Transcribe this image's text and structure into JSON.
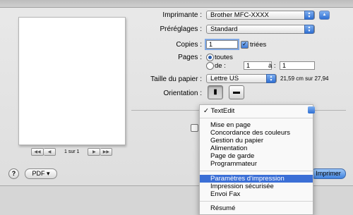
{
  "colors": {
    "accent": "#3b6fd6",
    "menu_highlight": "#3b6fd6"
  },
  "preview": {
    "page_label": "1 sur 1"
  },
  "printer": {
    "label": "Imprimante :",
    "value": "Brother MFC-XXXX"
  },
  "presets": {
    "label": "Préréglages :",
    "value": "Standard"
  },
  "copies": {
    "label": "Copies :",
    "value": "1",
    "collate_label": "triées"
  },
  "pages": {
    "label": "Pages :",
    "all_label": "toutes",
    "from_label": "de :",
    "from_value": "1",
    "to_label": "à :",
    "to_value": "1"
  },
  "paper": {
    "label": "Taille du papier :",
    "value": "Lettre US",
    "dimensions": "21,59 cm sur 27,94"
  },
  "orientation": {
    "label": "Orientation :"
  },
  "footer": {
    "help": "?",
    "pdf_label": "PDF ▾",
    "print_label": "Imprimer"
  },
  "menu": {
    "selected": "TextEdit",
    "group1": [
      "Mise en page",
      "Concordance des couleurs",
      "Gestion du papier",
      "Alimentation",
      "Page de garde",
      "Programmateur"
    ],
    "group2": [
      "Paramètres d'impression",
      "Impression sécurisée",
      "Envoi Fax"
    ],
    "group3": [
      "Résumé"
    ]
  }
}
